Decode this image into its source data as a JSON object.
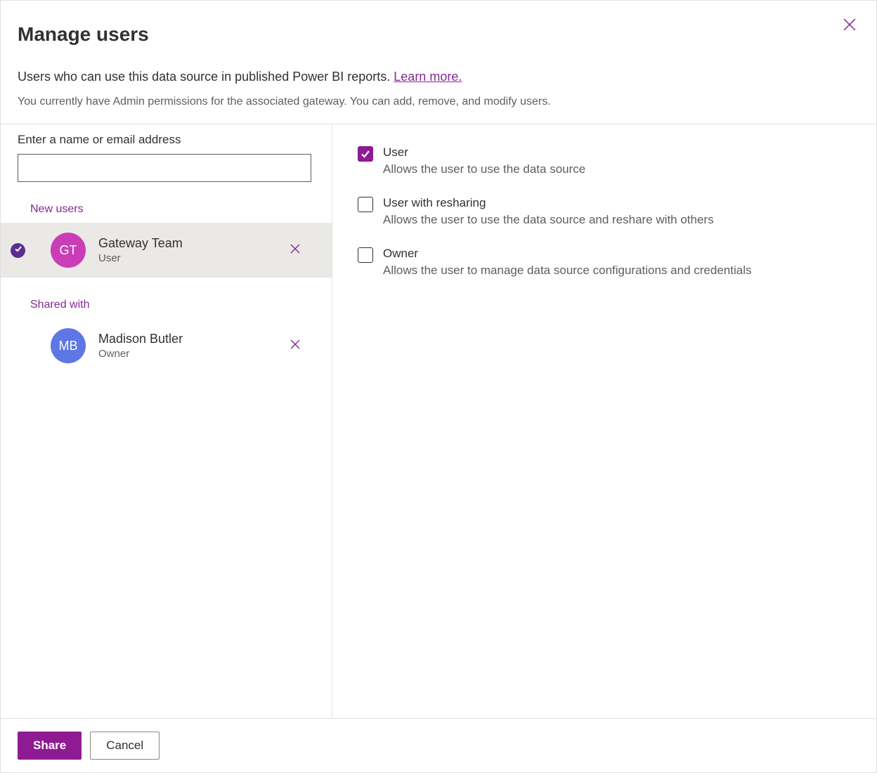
{
  "dialog": {
    "title": "Manage users",
    "description_text": "Users who can use this data source in published Power BI reports. ",
    "learn_more": "Learn more.",
    "sub_description": "You currently have Admin permissions for the associated gateway. You can add, remove, and modify users."
  },
  "left": {
    "search_label": "Enter a name or email address",
    "search_value": "",
    "new_users_label": "New users",
    "shared_with_label": "Shared with",
    "new_users": [
      {
        "initials": "GT",
        "name": "Gateway Team",
        "role": "User",
        "avatar_color": "purple",
        "selected": true
      }
    ],
    "shared_with": [
      {
        "initials": "MB",
        "name": "Madison Butler",
        "role": "Owner",
        "avatar_color": "blue",
        "selected": false
      }
    ]
  },
  "permissions": [
    {
      "key": "user",
      "label": "User",
      "desc": "Allows the user to use the data source",
      "checked": true
    },
    {
      "key": "reshare",
      "label": "User with resharing",
      "desc": "Allows the user to use the data source and reshare with others",
      "checked": false
    },
    {
      "key": "owner",
      "label": "Owner",
      "desc": "Allows the user to manage data source configurations and credentials",
      "checked": false
    }
  ],
  "footer": {
    "share": "Share",
    "cancel": "Cancel"
  }
}
